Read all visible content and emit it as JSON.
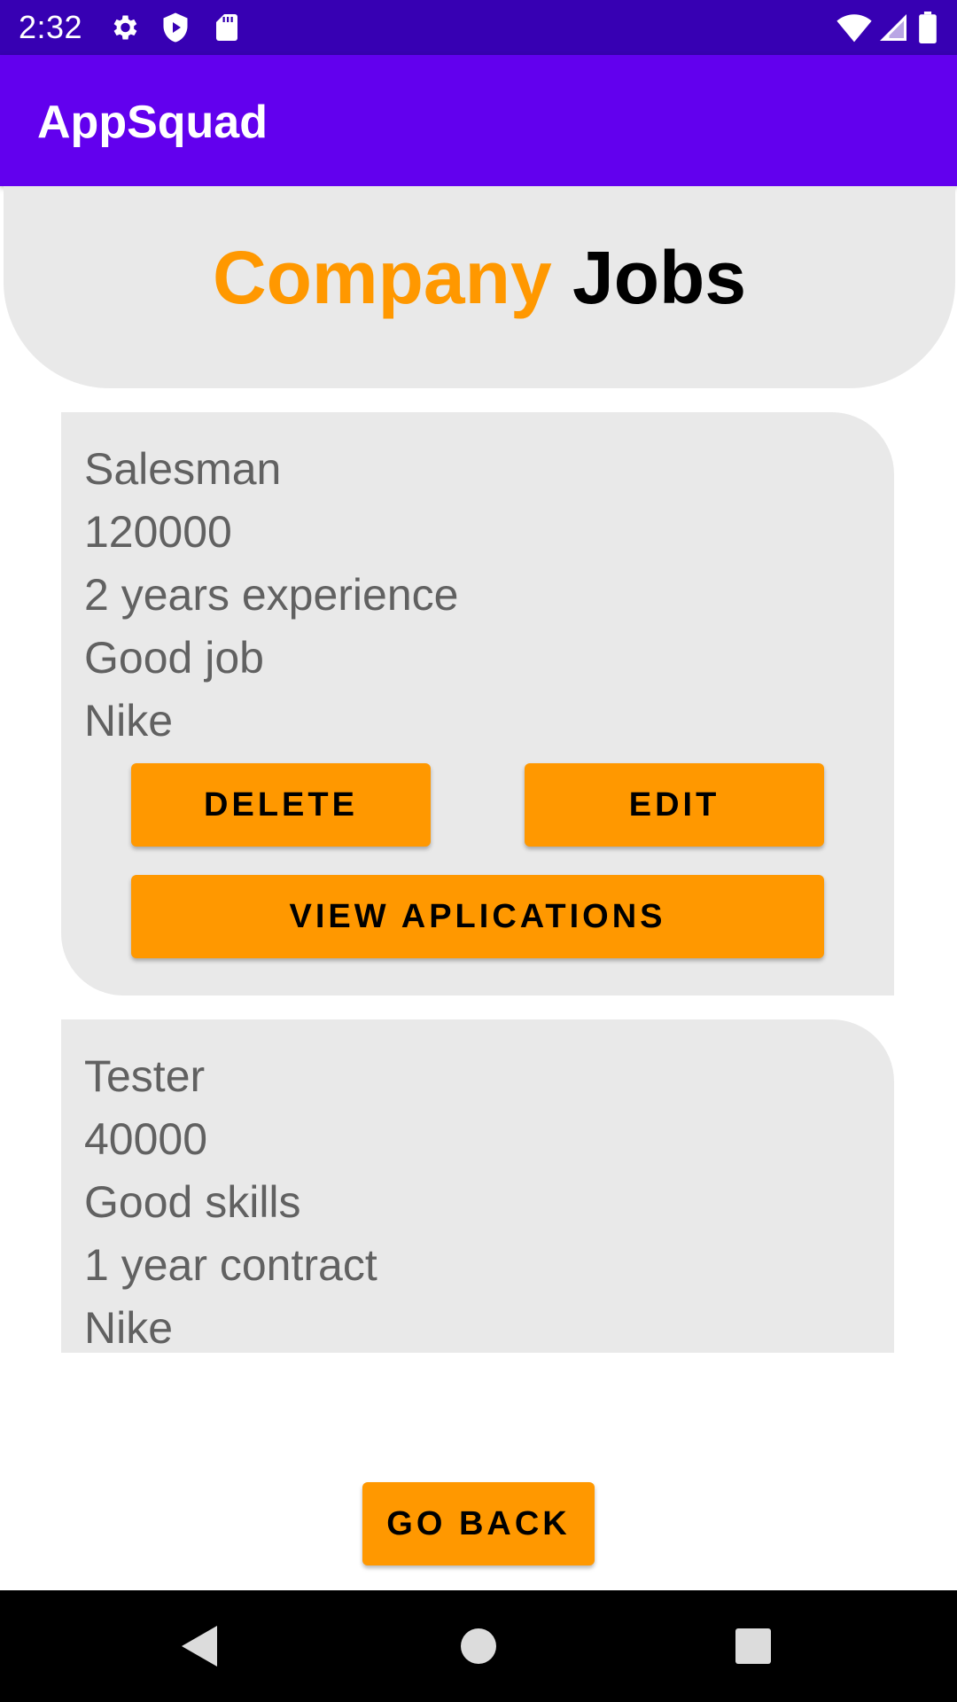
{
  "status_bar": {
    "time": "2:32",
    "left_icons": [
      "gear-icon",
      "shield-play-icon",
      "sd-card-icon"
    ],
    "right_icons": [
      "wifi-icon",
      "signal-icon",
      "battery-icon"
    ],
    "background": "#3700b3"
  },
  "app_bar": {
    "title": "AppSquad",
    "background": "#6200ee"
  },
  "header": {
    "title_part1": "Company",
    "title_part2": "Jobs",
    "accent_color": "#ff9800"
  },
  "jobs": [
    {
      "lines": [
        "Salesman",
        "120000",
        "2 years experience",
        "Good job",
        "Nike"
      ],
      "delete_label": "DELETE",
      "edit_label": "EDIT",
      "view_label": "VIEW APLICATIONS"
    },
    {
      "lines": [
        "Tester",
        "40000",
        "Good skills",
        "1 year contract",
        "Nike"
      ]
    }
  ],
  "footer": {
    "back_label": "GO BACK"
  },
  "nav_bar": {
    "icons": [
      "back-triangle-icon",
      "home-circle-icon",
      "recents-square-icon"
    ]
  }
}
